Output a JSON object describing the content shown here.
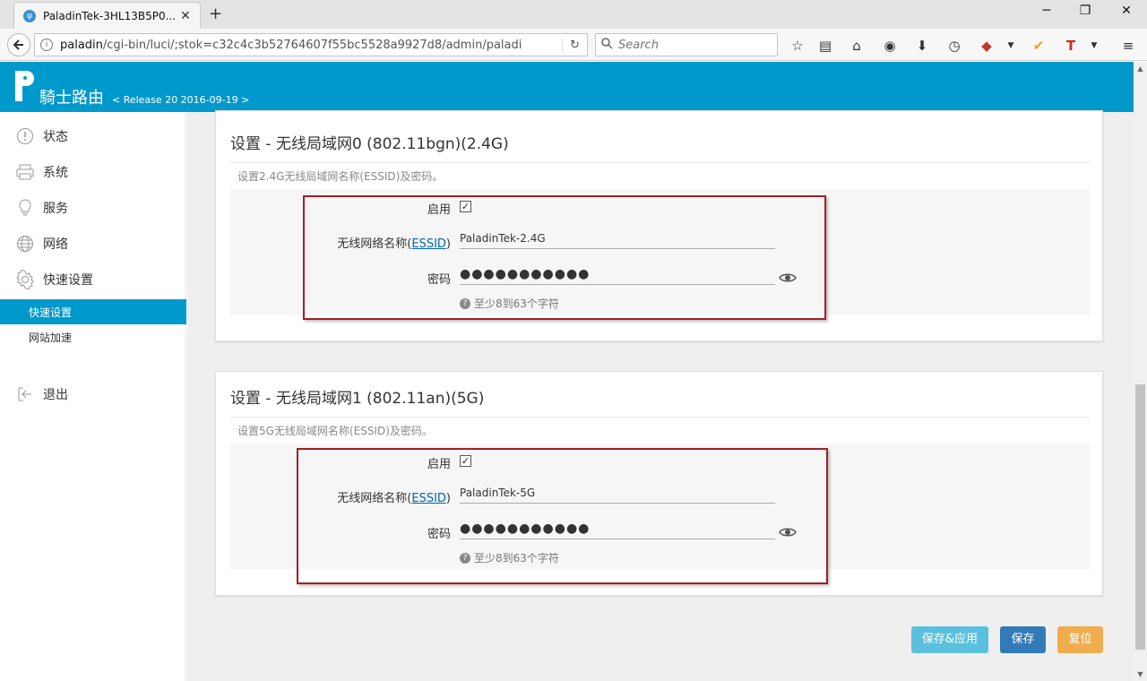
{
  "browser": {
    "tab_title": "PaladinTek-3HL13B5P0...",
    "tab_close": "✕",
    "new_tab": "+",
    "url_host": "paladin",
    "url_path": "/cgi-bin/luci/;stok=c32c4c3b52764607f55bc5528a9927d8/admin/paladi",
    "search_placeholder": "Search",
    "window_min": "─",
    "window_restore": "❐",
    "window_close": "✕"
  },
  "header": {
    "logo_text": "騎士路由",
    "release": "< Release 20 2016-09-19 >"
  },
  "sidebar": {
    "items": [
      {
        "label": "状态",
        "icon": "info-icon"
      },
      {
        "label": "系统",
        "icon": "printer-icon"
      },
      {
        "label": "服务",
        "icon": "lightbulb-icon"
      },
      {
        "label": "网络",
        "icon": "globe-icon"
      },
      {
        "label": "快速设置",
        "icon": "gear-icon"
      }
    ],
    "subitems": [
      {
        "label": "快速设置",
        "active": true
      },
      {
        "label": "网站加速",
        "active": false
      }
    ],
    "logout": "退出"
  },
  "wifi24": {
    "title": "设置 - 无线局域网0 (802.11bgn)(2.4G)",
    "desc": "设置2.4G无线局域网名称(ESSID)及密码。",
    "enable_label": "启用",
    "enabled": true,
    "ssid_label_prefix": "无线网络名称(",
    "ssid_label_link": "ESSID",
    "ssid_label_suffix": ")",
    "ssid_value": "PaladinTek-2.4G",
    "password_label": "密码",
    "password_mask": "●●●●●●●●●●●",
    "hint": "至少8到63个字符"
  },
  "wifi5": {
    "title": "设置 - 无线局域网1 (802.11an)(5G)",
    "desc": "设置5G无线局域网名称(ESSID)及密码。",
    "enable_label": "启用",
    "enabled": true,
    "ssid_label_prefix": "无线网络名称(",
    "ssid_label_link": "ESSID",
    "ssid_label_suffix": ")",
    "ssid_value": "PaladinTek-5G",
    "password_label": "密码",
    "password_mask": "●●●●●●●●●●●",
    "hint": "至少8到63个字符"
  },
  "actions": {
    "save_apply": "保存&应用",
    "save": "保存",
    "reset": "复位"
  },
  "colors": {
    "brand": "#0099cc",
    "highlight_box": "#a31f24"
  }
}
